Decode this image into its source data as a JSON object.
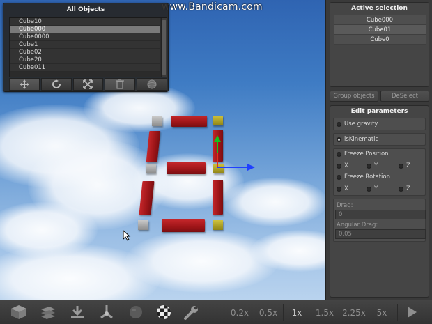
{
  "watermark": "www.Bandicam.com",
  "all_objects": {
    "title": "All Objects",
    "items": [
      "Cube10",
      "Cube000",
      "Cube0000",
      "Cube1",
      "Cube02",
      "Cube20",
      "Cube011"
    ],
    "highlighted_index": 1,
    "tools": [
      "move-icon",
      "rotate-icon",
      "scale-icon",
      "delete-icon",
      "sphere-icon"
    ]
  },
  "active_selection": {
    "title": "Active selection",
    "items": [
      "Cube000",
      "Cube01",
      "Cube0"
    ],
    "group_label": "Group objects",
    "deselect_label": "DeSelect"
  },
  "edit_parameters": {
    "title": "Edit parameters",
    "use_gravity": {
      "label": "Use gravity",
      "checked": false
    },
    "is_kinematic": {
      "label": "isKinematic",
      "checked": true
    },
    "freeze_position": {
      "label": "Freeze Position",
      "checked": false,
      "axes": [
        "X",
        "Y",
        "Z"
      ]
    },
    "freeze_rotation": {
      "label": "Freeze Rotation",
      "checked": false,
      "axes": [
        "X",
        "Y",
        "Z"
      ]
    },
    "drag": {
      "label": "Drag:",
      "value": "0"
    },
    "angular_drag": {
      "label": "Angular Drag:",
      "value": "0.05"
    }
  },
  "toolbar": {
    "icons": [
      "cube-icon",
      "layers-icon",
      "download-icon",
      "joint-icon",
      "sphere-icon",
      "checker-icon",
      "wrench-icon"
    ],
    "speeds": [
      "0.2x",
      "0.5x",
      "1x",
      "1.5x",
      "2.25x",
      "5x"
    ],
    "active_speed": "1x",
    "play_icon": "play-icon"
  },
  "colors": {
    "bar_red": "#9d1518",
    "corner_gray": "#a8a8a8",
    "corner_selected": "#b3a52a",
    "gizmo_x": "#1f3fff",
    "gizmo_y": "#12c21b",
    "gizmo_z": "#e03020",
    "panel_bg": "#3a3a3a"
  }
}
